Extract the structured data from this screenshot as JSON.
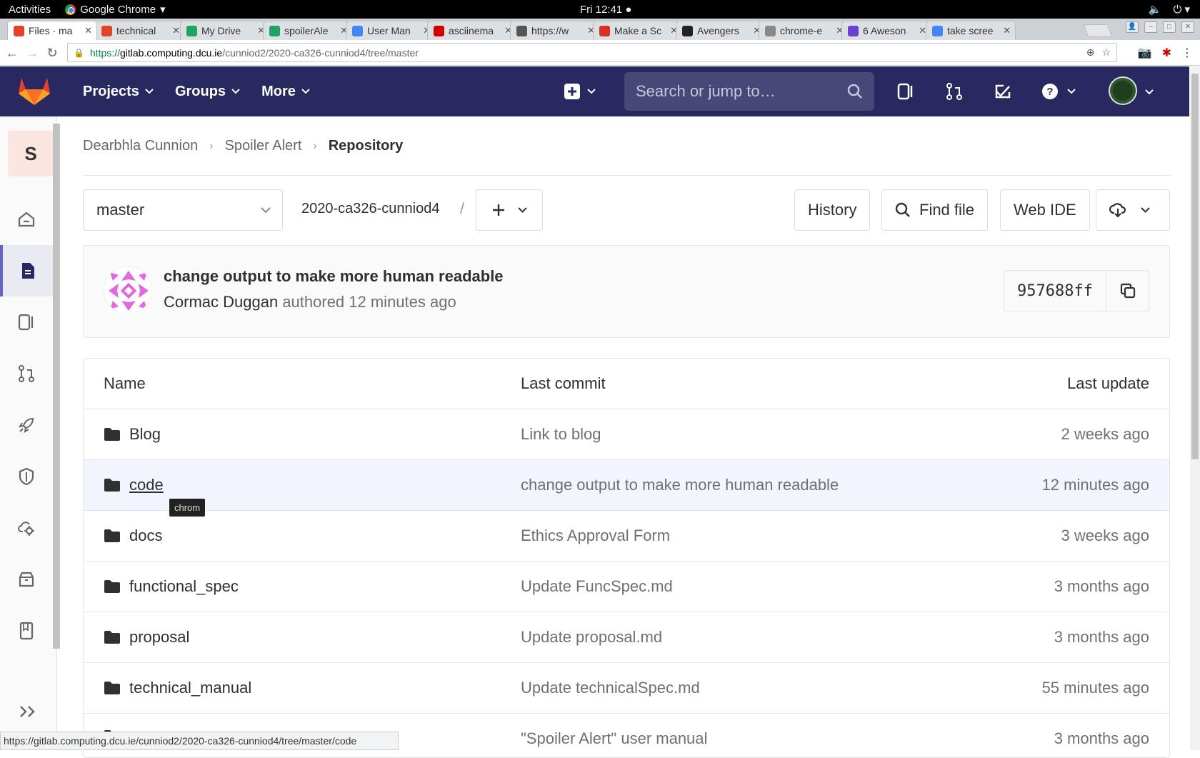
{
  "system_bar": {
    "activities": "Activities",
    "app_name": "Google Chrome",
    "clock": "Fri 12:41 ●"
  },
  "browser": {
    "tabs": [
      {
        "label": "Files · ma",
        "icon": "gitlab-icon",
        "active": true
      },
      {
        "label": "technical",
        "icon": "gitlab-icon"
      },
      {
        "label": "My Drive",
        "icon": "drive-icon"
      },
      {
        "label": "spoilerAle",
        "icon": "drive-icon"
      },
      {
        "label": "User Man",
        "icon": "docs-icon"
      },
      {
        "label": "asciinema",
        "icon": "asciinema-icon"
      },
      {
        "label": "https://w",
        "icon": "dcu-icon"
      },
      {
        "label": "Make a Sc",
        "icon": "gmail-icon"
      },
      {
        "label": "Avengers",
        "icon": "sr-icon"
      },
      {
        "label": "chrome-e",
        "icon": "page-icon"
      },
      {
        "label": "6 Aweson",
        "icon": "flickr-icon"
      },
      {
        "label": "take scree",
        "icon": "google-icon"
      }
    ],
    "url_scheme": "https://",
    "url_host": "gitlab.computing.dcu.ie",
    "url_path": "/cunniod2/2020-ca326-cunniod4/tree/master",
    "status_url": "https://gitlab.computing.dcu.ie/cunniod2/2020-ca326-cunniod4/tree/master/code"
  },
  "header": {
    "nav": [
      "Projects",
      "Groups",
      "More"
    ],
    "search_placeholder": "Search or jump to…"
  },
  "sidebar": {
    "project_initial": "S",
    "items": [
      "home-icon",
      "repository-icon",
      "issues-icon",
      "merge-requests-icon",
      "ci-cd-icon",
      "security-icon",
      "operations-icon",
      "packages-icon",
      "wiki-icon"
    ]
  },
  "breadcrumb": {
    "owner": "Dearbhla Cunnion",
    "project": "Spoiler Alert",
    "current": "Repository"
  },
  "controls": {
    "branch": "master",
    "repo_path": "2020-ca326-cunniod4",
    "path_separator": "/",
    "history": "History",
    "find_file": "Find file",
    "web_ide": "Web IDE"
  },
  "commit": {
    "title": "change output to make more human readable",
    "author": "Cormac Duggan",
    "authored": "authored 12 minutes ago",
    "sha": "957688ff"
  },
  "tree": {
    "headers": {
      "name": "Name",
      "last_commit": "Last commit",
      "last_update": "Last update"
    },
    "rows": [
      {
        "name": "Blog",
        "commit": "Link to blog",
        "updated": "2 weeks ago"
      },
      {
        "name": "code",
        "commit": "change output to make more human readable",
        "updated": "12 minutes ago"
      },
      {
        "name": "docs",
        "commit": "Ethics Approval Form",
        "updated": "3 weeks ago"
      },
      {
        "name": "functional_spec",
        "commit": "Update FuncSpec.md",
        "updated": "3 months ago"
      },
      {
        "name": "proposal",
        "commit": "Update proposal.md",
        "updated": "3 months ago"
      },
      {
        "name": "technical_manual",
        "commit": "Update technicalSpec.md",
        "updated": "55 minutes ago"
      },
      {
        "name": "",
        "commit": "\"Spoiler Alert\" user manual",
        "updated": "3 months ago"
      }
    ],
    "tooltip": "chrom"
  }
}
